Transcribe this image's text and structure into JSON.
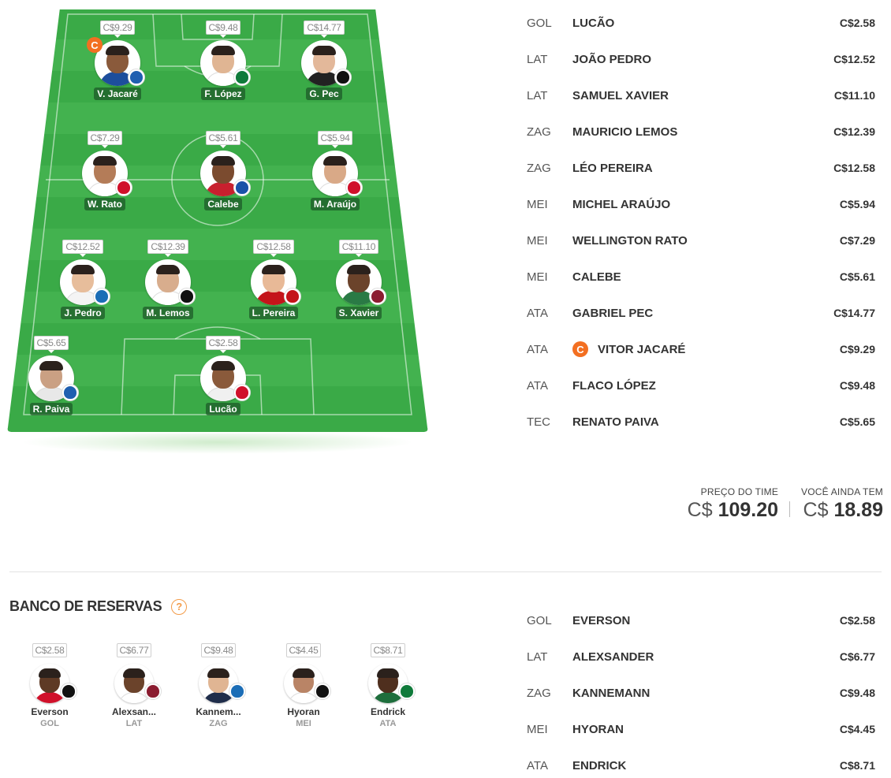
{
  "field": {
    "players": [
      {
        "name": "V. Jacaré",
        "price": "C$9.29",
        "captain": true,
        "captain_label": "C",
        "shirt": "#1d4e9c",
        "skin": "#8a5a3b",
        "crest": "#1f5fb0"
      },
      {
        "name": "F. López",
        "price": "C$9.48",
        "shirt": "#ffffff",
        "skin": "#e0b593",
        "crest": "#0f7a3a"
      },
      {
        "name": "G. Pec",
        "price": "C$14.77",
        "shirt": "#222222",
        "skin": "#e3b89a",
        "crest": "#111111"
      },
      {
        "name": "W. Rato",
        "price": "C$7.29",
        "shirt": "#ffffff",
        "skin": "#b47c58",
        "crest": "#d0102a"
      },
      {
        "name": "Calebe",
        "price": "C$5.61",
        "shirt": "#c8202e",
        "skin": "#7b4b2f",
        "crest": "#1a52a8"
      },
      {
        "name": "M. Araújo",
        "price": "C$5.94",
        "shirt": "#ffffff",
        "skin": "#d9a987",
        "crest": "#d0102a"
      },
      {
        "name": "J. Pedro",
        "price": "C$12.52",
        "shirt": "#f4f4f4",
        "skin": "#e7bd9b",
        "crest": "#1b6db6"
      },
      {
        "name": "M. Lemos",
        "price": "C$12.39",
        "shirt": "#ffffff",
        "skin": "#d8ad8d",
        "crest": "#111111"
      },
      {
        "name": "L. Pereira",
        "price": "C$12.58",
        "shirt": "#c4141a",
        "skin": "#e8b997",
        "crest": "#c4141a"
      },
      {
        "name": "S. Xavier",
        "price": "C$11.10",
        "shirt": "#2a7a45",
        "skin": "#6b432b",
        "crest": "#8b1c30"
      },
      {
        "name": "R. Paiva",
        "price": "C$5.65",
        "shirt": "#e8e8e8",
        "skin": "#caa083",
        "crest": "#1f5fb0"
      },
      {
        "name": "Lucão",
        "price": "C$2.58",
        "shirt": "#f0f0f0",
        "skin": "#8a5a3b",
        "crest": "#d0102a"
      }
    ]
  },
  "roster": [
    {
      "pos": "GOL",
      "name": "LUCÃO",
      "price": "C$2.58"
    },
    {
      "pos": "LAT",
      "name": "JOÃO PEDRO",
      "price": "C$12.52"
    },
    {
      "pos": "LAT",
      "name": "SAMUEL XAVIER",
      "price": "C$11.10"
    },
    {
      "pos": "ZAG",
      "name": "MAURICIO LEMOS",
      "price": "C$12.39"
    },
    {
      "pos": "ZAG",
      "name": "LÉO PEREIRA",
      "price": "C$12.58"
    },
    {
      "pos": "MEI",
      "name": "MICHEL ARAÚJO",
      "price": "C$5.94"
    },
    {
      "pos": "MEI",
      "name": "WELLINGTON RATO",
      "price": "C$7.29"
    },
    {
      "pos": "MEI",
      "name": "CALEBE",
      "price": "C$5.61"
    },
    {
      "pos": "ATA",
      "name": "GABRIEL PEC",
      "price": "C$14.77"
    },
    {
      "pos": "ATA",
      "name": "VITOR JACARÉ",
      "price": "C$9.29",
      "captain": true,
      "captain_label": "C"
    },
    {
      "pos": "ATA",
      "name": "FLACO LÓPEZ",
      "price": "C$9.48"
    },
    {
      "pos": "TEC",
      "name": "RENATO PAIVA",
      "price": "C$5.65"
    }
  ],
  "totals": {
    "team_price_label": "PREÇO DO TIME",
    "team_price_currency": "C$",
    "team_price_value": "109.20",
    "remaining_label": "VOCÊ AINDA TEM",
    "remaining_currency": "C$",
    "remaining_value": "18.89"
  },
  "bench": {
    "title": "BANCO DE RESERVAS",
    "help_label": "?",
    "players": [
      {
        "name": "Everson",
        "pos": "GOL",
        "price": "C$2.58",
        "shirt": "#d0102a",
        "skin": "#5e3a25",
        "crest": "#111111"
      },
      {
        "name": "Alexsan...",
        "pos": "LAT",
        "price": "C$6.77",
        "shirt": "#ffffff",
        "skin": "#6b432b",
        "crest": "#8b1c30"
      },
      {
        "name": "Kannem...",
        "pos": "ZAG",
        "price": "C$9.48",
        "shirt": "#1f2d4a",
        "skin": "#e0b593",
        "crest": "#1b6db6"
      },
      {
        "name": "Hyoran",
        "pos": "MEI",
        "price": "C$4.45",
        "shirt": "#ffffff",
        "skin": "#b98466",
        "crest": "#111111"
      },
      {
        "name": "Endrick",
        "pos": "ATA",
        "price": "C$8.71",
        "shirt": "#1e6e3c",
        "skin": "#4f2f1e",
        "crest": "#0f7a3a"
      }
    ]
  },
  "bench_roster": [
    {
      "pos": "GOL",
      "name": "EVERSON",
      "price": "C$2.58"
    },
    {
      "pos": "LAT",
      "name": "ALEXSANDER",
      "price": "C$6.77"
    },
    {
      "pos": "ZAG",
      "name": "KANNEMANN",
      "price": "C$9.48"
    },
    {
      "pos": "MEI",
      "name": "HYORAN",
      "price": "C$4.45"
    },
    {
      "pos": "ATA",
      "name": "ENDRICK",
      "price": "C$8.71"
    }
  ],
  "colors": {
    "pitch": "#3aaa47",
    "pitch_stripe": "#43b24f",
    "captain": "#f36f21",
    "help": "#f39c4a"
  }
}
